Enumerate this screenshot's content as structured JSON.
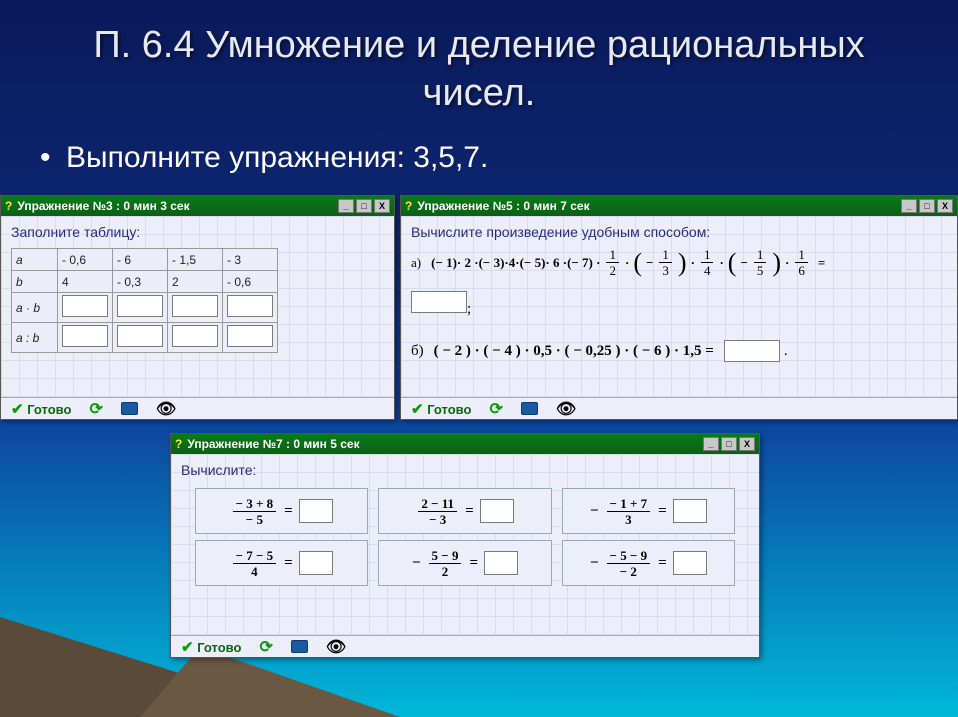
{
  "slide": {
    "title": "П. 6.4 Умножение и деление рациональных чисел.",
    "bullet": "Выполните упражнения: 3,5,7."
  },
  "footer_label": "Готово",
  "winbuttons": {
    "min": "_",
    "max": "□",
    "close": "X"
  },
  "win3": {
    "title": "Упражнение №3 : 0 мин  3 сек",
    "prompt": "Заполните таблицу:",
    "rows": {
      "a_label": "a",
      "b_label": "b",
      "ab_label": "a · b",
      "adivb_label": "a : b",
      "a": [
        "- 0,6",
        "- 6",
        "- 1,5",
        "- 3"
      ],
      "b": [
        "4",
        "- 0,3",
        "2",
        "- 0,6"
      ]
    }
  },
  "win5": {
    "title": "Упражнение №5 : 0 мин  7 сек",
    "prompt": "Вычислите произведение удобным способом:",
    "label_a": "а)",
    "label_b": "б)",
    "expr_a_prefix": "(− 1)· 2 ·(− 3)·4·(− 5)· 6 ·(− 7) ·",
    "frac1": {
      "n": "1",
      "d": "2"
    },
    "frac2": {
      "n": "1",
      "d": "3"
    },
    "frac3": {
      "n": "1",
      "d": "4"
    },
    "frac4": {
      "n": "1",
      "d": "5"
    },
    "frac5": {
      "n": "1",
      "d": "6"
    },
    "expr_b": "( − 2 ) · ( − 4 ) · 0,5 · ( − 0,25 ) · ( − 6 ) · 1,5 ="
  },
  "win7": {
    "title": "Упражнение №7 : 0 мин  5 сек",
    "prompt": "Вычислите:",
    "cells": [
      {
        "pre": "",
        "n": "− 3 + 8",
        "d": "− 5"
      },
      {
        "pre": "",
        "n": "2 − 11",
        "d": "− 3"
      },
      {
        "pre": "−",
        "n": "− 1 + 7",
        "d": "3"
      },
      {
        "pre": "",
        "n": "− 7 − 5",
        "d": "4"
      },
      {
        "pre": "−",
        "n": "5 − 9",
        "d": "2"
      },
      {
        "pre": "−",
        "n": "− 5 − 9",
        "d": "− 2"
      }
    ]
  }
}
